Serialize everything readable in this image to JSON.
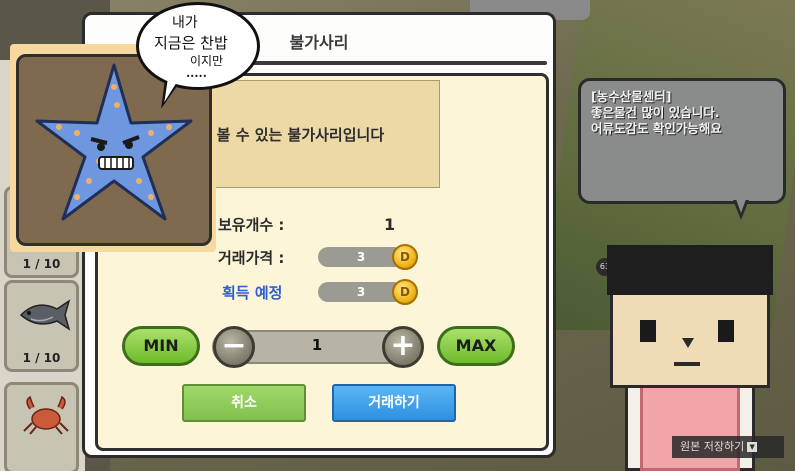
{
  "dialog": {
    "title": "불가사리",
    "description": "흔히 볼 수 있는 불가사리입니다",
    "owned_label": "보유개수 :",
    "owned_value": "1",
    "price_label": "거래가격 :",
    "price_value": "3",
    "gain_label": "획득 예정",
    "gain_value": "3",
    "coin_symbol": "D",
    "min_label": "MIN",
    "max_label": "MAX",
    "minus_symbol": "−",
    "plus_symbol": "+",
    "quantity": "1",
    "cancel_label": "취소",
    "trade_label": "거래하기"
  },
  "speech_bubble": {
    "lines": [
      "내가",
      "지금은 찬밥",
      "이지만",
      "....."
    ]
  },
  "inventory": {
    "slots": [
      {
        "count": "1 / 10",
        "icon": "starfish-icon"
      },
      {
        "count": "1 / 10",
        "icon": "fish-icon"
      },
      {
        "count": "",
        "icon": "crab-icon"
      }
    ]
  },
  "npc_tooltip": {
    "line1": "[농수산물센터]",
    "line2": "좋은물건 많이 있습니다.",
    "line3": "어류도감도 확인가능해요"
  },
  "npc_badge": "63",
  "save_bar": {
    "label": "원본 저장하기",
    "arrow": "▼"
  },
  "colors": {
    "green_button": "#82c04d",
    "blue_button": "#2f8fe0",
    "gain_label": "#2e5fcf",
    "coin": "#f0b41c"
  }
}
